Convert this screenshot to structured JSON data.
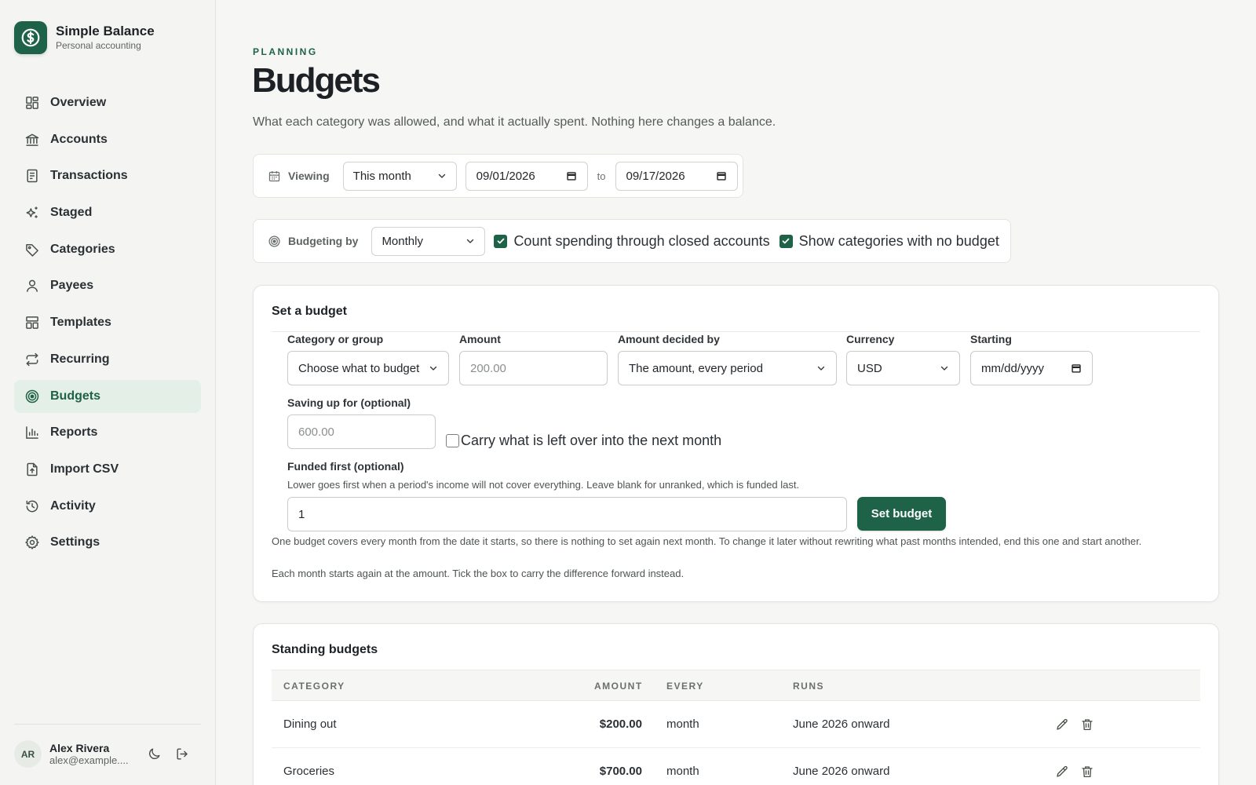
{
  "app": {
    "name": "Simple Balance",
    "tagline": "Personal accounting"
  },
  "colors": {
    "brand": "#1e6247",
    "active_bg": "#e3efe7",
    "page_bg": "#f6f6f4"
  },
  "sidebar": {
    "items": [
      {
        "label": "Overview",
        "icon": "grid-icon"
      },
      {
        "label": "Accounts",
        "icon": "bank-icon"
      },
      {
        "label": "Transactions",
        "icon": "receipt-icon"
      },
      {
        "label": "Staged",
        "icon": "sparkle-icon"
      },
      {
        "label": "Categories",
        "icon": "tag-icon"
      },
      {
        "label": "Payees",
        "icon": "person-icon"
      },
      {
        "label": "Templates",
        "icon": "template-icon"
      },
      {
        "label": "Recurring",
        "icon": "repeat-icon"
      },
      {
        "label": "Budgets",
        "icon": "target-icon",
        "active": true
      },
      {
        "label": "Reports",
        "icon": "bar-chart-icon"
      },
      {
        "label": "Import CSV",
        "icon": "file-upload-icon"
      },
      {
        "label": "Activity",
        "icon": "history-icon"
      },
      {
        "label": "Settings",
        "icon": "gear-icon"
      }
    ]
  },
  "user": {
    "initials": "AR",
    "name": "Alex Rivera",
    "email": "alex@example...."
  },
  "page": {
    "eyebrow": "PLANNING",
    "title": "Budgets",
    "subtitle": "What each category was allowed, and what it actually spent. Nothing here changes a balance."
  },
  "viewing": {
    "label": "Viewing",
    "period": "This month",
    "from": "09/01/2026",
    "to_label": "to",
    "to": "09/17/2026"
  },
  "budgeting": {
    "label": "Budgeting by",
    "frequency": "Monthly",
    "closed_accounts_label": "Count spending through closed accounts",
    "closed_accounts_checked": true,
    "no_budget_label": "Show categories with no budget",
    "no_budget_checked": true
  },
  "set_budget": {
    "title": "Set a budget",
    "category_label": "Category or group",
    "category_value": "Choose what to budget",
    "amount_label": "Amount",
    "amount_placeholder": "200.00",
    "decided_label": "Amount decided by",
    "decided_value": "The amount, every period",
    "currency_label": "Currency",
    "currency_value": "USD",
    "starting_label": "Starting",
    "starting_placeholder": "mm/dd/yyyy",
    "saving_label": "Saving up for (optional)",
    "saving_placeholder": "600.00",
    "carry_label": "Carry what is left over into the next month",
    "carry_checked": false,
    "funded_label": "Funded first (optional)",
    "funded_hint": "Lower goes first when a period's income will not cover everything. Leave blank for unranked, which is funded last.",
    "funded_value": "1",
    "submit_label": "Set budget",
    "note_1": "One budget covers every month from the date it starts, so there is nothing to set again next month. To change it later without rewriting what past months intended, end this one and start another.",
    "note_2": "Each month starts again at the amount. Tick the box to carry the difference forward instead."
  },
  "standing": {
    "title": "Standing budgets",
    "columns": {
      "category": "CATEGORY",
      "amount": "AMOUNT",
      "every": "EVERY",
      "runs": "RUNS"
    },
    "rows": [
      {
        "category": "Dining out",
        "amount": "$200.00",
        "every": "month",
        "runs": "June 2026 onward"
      },
      {
        "category": "Groceries",
        "amount": "$700.00",
        "every": "month",
        "runs": "June 2026 onward"
      }
    ]
  }
}
